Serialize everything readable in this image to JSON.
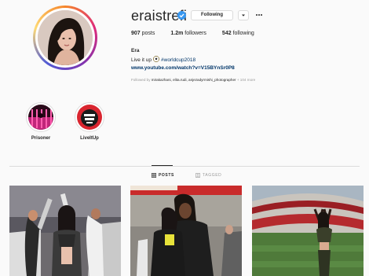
{
  "profile": {
    "username": "eraistrefi",
    "verified": true,
    "follow_state_label": "Following",
    "stats": {
      "posts_count": "907",
      "posts_label": "posts",
      "followers_count": "1.2m",
      "followers_label": "followers",
      "following_count": "542",
      "following_label": "following"
    },
    "bio": {
      "name": "Era",
      "line_text": "Live it up",
      "emoji_icon": "soccer-ball-icon",
      "hashtag": "#worldcup2018",
      "link": "www.youtube.com/watch?v=V15BYnSr0P8"
    },
    "followed_by": {
      "prefix": "Followed by",
      "names": "mirakazhani, elita.rudi, anjezadyrmishi_photographer",
      "suffix": "+ 104 more"
    }
  },
  "highlights": [
    {
      "label": "Prisoner"
    },
    {
      "label": "LiveItUp"
    }
  ],
  "tabs": {
    "posts_label": "POSTS",
    "tagged_label": "TAGGED",
    "active": "posts"
  },
  "colors": {
    "verified_blue": "#3897f0",
    "link_blue": "#003569",
    "border_gray": "#dbdbdb",
    "background": "#fafafa"
  }
}
